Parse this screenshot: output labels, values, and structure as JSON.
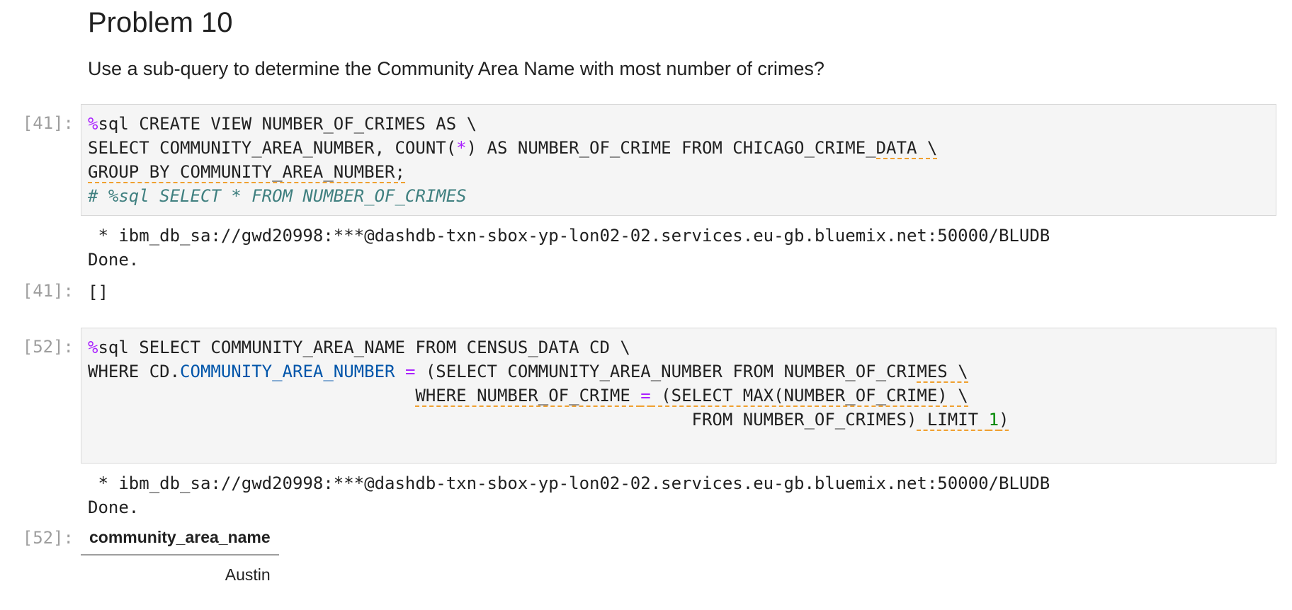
{
  "markdown": {
    "heading": "Problem 10",
    "paragraph": "Use a sub-query to determine the Community Area Name with most number of crimes?"
  },
  "cell1": {
    "prompt_in": "[41]:",
    "prompt_out": "[41]:",
    "line1": {
      "magic": "%",
      "rest": "sql CREATE VIEW NUMBER_OF_CRIMES AS \\"
    },
    "line2": {
      "a": "SELECT COMMUNITY_AREA_NUMBER, COUNT(",
      "star": "*",
      "b": ") AS NUMBER_OF_CRIME FROM CHICAGO_CRIME_",
      "c": "DATA \\"
    },
    "line3": "GROUP BY COMMUNITY_AREA_NUMBER;",
    "line4": "# %sql SELECT * FROM NUMBER_OF_CRIMES",
    "stdout1": " * ibm_db_sa://gwd20998:***@dashdb-txn-sbox-yp-lon02-02.services.eu-gb.bluemix.net:50000/BLUDB",
    "stdout2": "Done.",
    "result": "[]"
  },
  "cell2": {
    "prompt_in": "[52]:",
    "prompt_out": "[52]:",
    "line1": {
      "magic": "%",
      "rest": "sql SELECT COMMUNITY_AREA_NAME FROM CENSUS_DATA CD \\"
    },
    "line2": {
      "a": "WHERE CD.",
      "attr": "COMMUNITY_AREA_NUMBER",
      "sp": " ",
      "eq": "=",
      "b": " (SELECT COMMUNITY_AREA_NUMBER FROM NUMBER_OF_CRI",
      "c": "MES \\"
    },
    "line3": {
      "indent": "                                ",
      "a": "WHERE NUMBER_OF_CRIME ",
      "eq": "=",
      "b": " (SELECT MAX(NUMBER_OF_CRIME) \\"
    },
    "line4": {
      "indent": "                                                           ",
      "a": "FROM NUMBER_OF_CRIMES)",
      "b": " LIMIT ",
      "num": "1",
      "c": ")"
    },
    "stdout1": " * ibm_db_sa://gwd20998:***@dashdb-txn-sbox-yp-lon02-02.services.eu-gb.bluemix.net:50000/BLUDB",
    "stdout2": "Done.",
    "table": {
      "header": "community_area_name",
      "rows": [
        "Austin"
      ]
    }
  }
}
